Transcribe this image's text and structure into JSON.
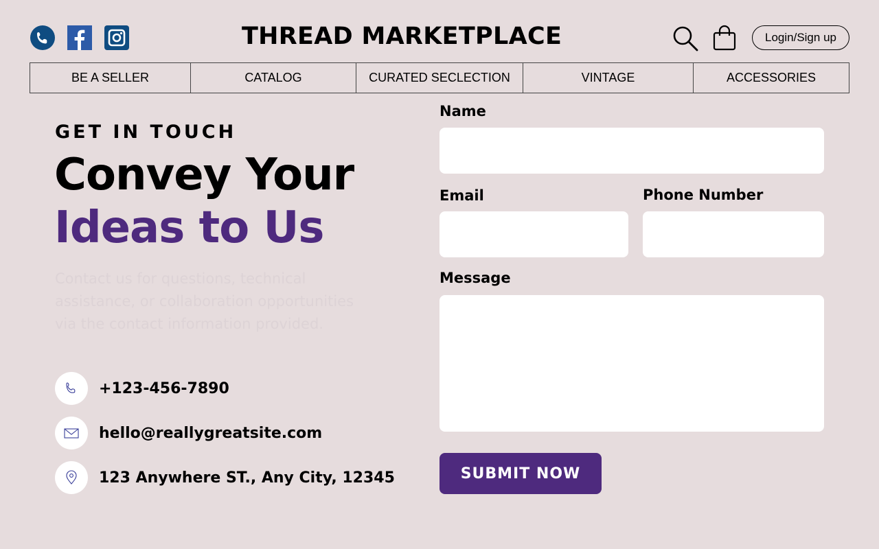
{
  "header": {
    "brand": "THREAD MARKETPLACE",
    "login_label": "Login/Sign up",
    "social": [
      "phone-icon",
      "facebook-icon",
      "instagram-icon"
    ],
    "social_color": "#0f4c81"
  },
  "nav": {
    "items": [
      {
        "label": "BE A SELLER"
      },
      {
        "label": "CATALOG"
      },
      {
        "label": "CURATED SECLECTION"
      },
      {
        "label": "VINTAGE"
      },
      {
        "label": "ACCESSORIES"
      }
    ]
  },
  "hero": {
    "eyebrow": "GET IN TOUCH",
    "title_line1": "Convey Your",
    "title_line2": "Ideas to Us",
    "accent_color": "#4e2a7e",
    "description": "Contact us for questions, technical assistance, or collaboration opportunities via the contact information provided."
  },
  "contact": {
    "phone": "+123-456-7890",
    "email": "hello@reallygreatsite.com",
    "address": "123 Anywhere ST., Any City, 12345"
  },
  "form": {
    "name_label": "Name",
    "email_label": "Email",
    "phone_label": "Phone Number",
    "message_label": "Message",
    "name_value": "",
    "email_value": "",
    "phone_value": "",
    "message_value": "",
    "submit_label": "SUBMIT NOW"
  }
}
